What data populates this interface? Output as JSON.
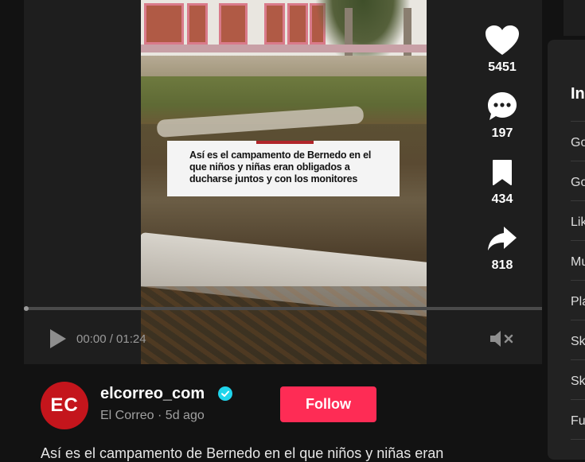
{
  "video": {
    "caption": "Así es el campamento de Bernedo en el que niños y niñas eran obligados a ducharse juntos y con los monitores",
    "time": "00:00 / 01:24",
    "progress": 0.0
  },
  "actions": {
    "like_count": "5451",
    "comment_count": "197",
    "save_count": "434",
    "share_count": "818"
  },
  "channel": {
    "avatar_text": "EC",
    "handle": "elcorreo_com",
    "display_name": "El Correo",
    "age": "5d ago",
    "separator": " · ",
    "follow_label": "Follow",
    "description": "Así es el campamento de Bernedo en el que niños y niñas eran"
  },
  "side_panel": {
    "title": "In",
    "items": [
      "Go",
      "Go",
      "Lik",
      "Mu",
      "Pla",
      "Sk",
      "Sk",
      "Fu"
    ]
  },
  "colors": {
    "accent": "#fe2c55",
    "avatar": "#c4151c",
    "verified": "#20d5ec"
  },
  "icons": {
    "like": "heart-icon",
    "comment": "comment-icon",
    "save": "bookmark-icon",
    "share": "share-icon",
    "play": "play-icon",
    "mute": "mute-icon",
    "verified": "verified-badge-icon"
  }
}
